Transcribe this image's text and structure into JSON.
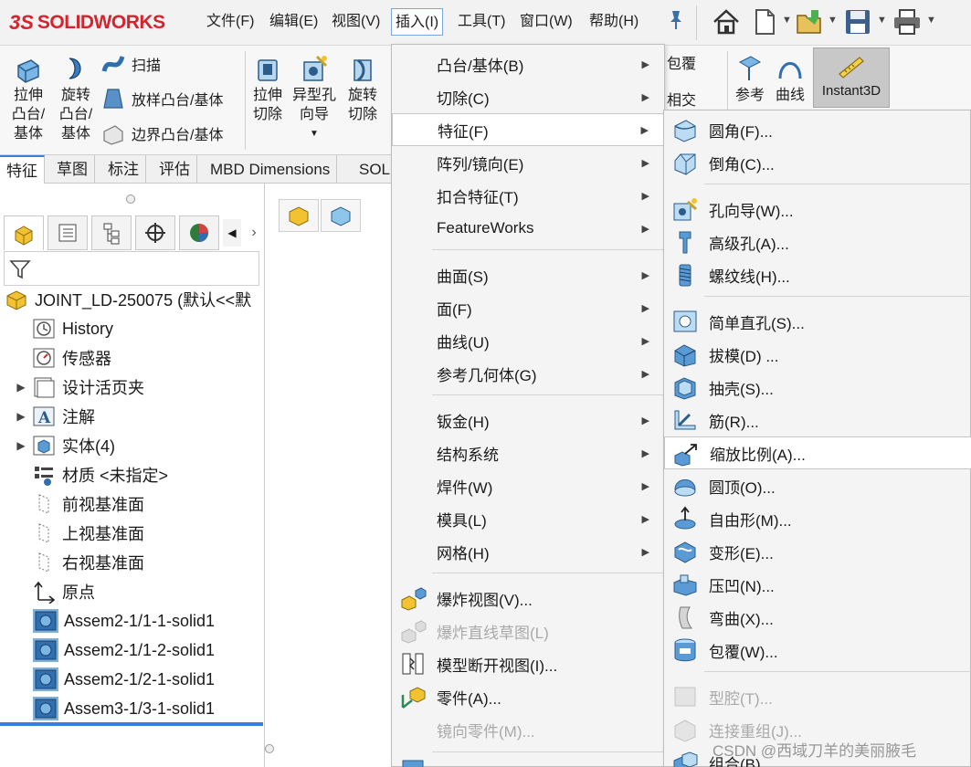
{
  "app": {
    "logo_prefix": "3S",
    "logo_text": "SOLIDWORKS",
    "accent": "#d6232e",
    "selection_color": "#9dc3e6",
    "highlight_blue": "#3b7dd8"
  },
  "menubar": [
    {
      "label": "文件(F)"
    },
    {
      "label": "编辑(E)"
    },
    {
      "label": "视图(V)"
    },
    {
      "label": "插入(I)",
      "active": true
    },
    {
      "label": "工具(T)"
    },
    {
      "label": "窗口(W)"
    },
    {
      "label": "帮助(H)"
    }
  ],
  "quick_access": [
    "home-icon",
    "new-document-icon",
    "open-icon",
    "save-icon",
    "print-icon"
  ],
  "commands": {
    "extrude_boss": "拉伸\n凸台/\n基体",
    "revolve_boss": "旋转\n凸台/\n基体",
    "sweep": "扫描",
    "loft": "放样凸台/基体",
    "boundary": "边界凸台/基体",
    "extrude_cut": "拉伸\n切除",
    "hole_wizard": "异型孔\n向导",
    "revolve_cut": "旋转\n切除",
    "wrap": "包覆",
    "intersect": "相交",
    "reference": "参考",
    "curves": "曲线",
    "instant3d": "Instant3D"
  },
  "command_tabs": [
    {
      "label": "特征",
      "active": true
    },
    {
      "label": "草图"
    },
    {
      "label": "标注"
    },
    {
      "label": "评估"
    },
    {
      "label": "MBD Dimensions"
    },
    {
      "label": "SOL"
    }
  ],
  "tree": {
    "root": "JOINT_LD-250075  (默认<<默",
    "items": [
      {
        "label": "History",
        "icon": "history-icon",
        "expandable": false
      },
      {
        "label": "传感器",
        "icon": "sensor-icon",
        "expandable": false
      },
      {
        "label": "设计活页夹",
        "icon": "design-binder-icon",
        "expandable": true
      },
      {
        "label": "注解",
        "icon": "annotation-icon",
        "expandable": true
      },
      {
        "label": "实体(4)",
        "icon": "solid-bodies-icon",
        "expandable": true
      },
      {
        "label": "材质 <未指定>",
        "icon": "material-icon",
        "expandable": false
      },
      {
        "label": "前视基准面",
        "icon": "plane-icon",
        "expandable": false
      },
      {
        "label": "上视基准面",
        "icon": "plane-icon",
        "expandable": false
      },
      {
        "label": "右视基准面",
        "icon": "plane-icon",
        "expandable": false
      },
      {
        "label": "原点",
        "icon": "origin-icon",
        "expandable": false
      },
      {
        "label": "Assem2-1/1-1-solid1",
        "icon": "part-body-icon",
        "selected": true
      },
      {
        "label": "Assem2-1/1-2-solid1",
        "icon": "part-body-icon",
        "selected": true
      },
      {
        "label": "Assem2-1/2-1-solid1",
        "icon": "part-body-icon",
        "selected": true
      },
      {
        "label": "Assem3-1/3-1-solid1",
        "icon": "part-body-icon",
        "selected": true
      }
    ]
  },
  "insert_menu": {
    "items": [
      {
        "label": "凸台/基体(B)",
        "submenu": true
      },
      {
        "label": "切除(C)",
        "submenu": true
      },
      {
        "label": "特征(F)",
        "submenu": true,
        "hover": true
      },
      {
        "label": "阵列/镜向(E)",
        "submenu": true
      },
      {
        "label": "扣合特征(T)",
        "submenu": true
      },
      {
        "label": "FeatureWorks",
        "submenu": true
      },
      {
        "label": "曲面(S)",
        "submenu": true
      },
      {
        "label": "面(F)",
        "submenu": true
      },
      {
        "label": "曲线(U)",
        "submenu": true
      },
      {
        "label": "参考几何体(G)",
        "submenu": true
      },
      {
        "label": "钣金(H)",
        "submenu": true
      },
      {
        "label": "结构系统",
        "submenu": true
      },
      {
        "label": "焊件(W)",
        "submenu": true
      },
      {
        "label": "模具(L)",
        "submenu": true
      },
      {
        "label": "网格(H)",
        "submenu": true
      },
      {
        "label": "爆炸视图(V)...",
        "icon": "exploded-view-icon"
      },
      {
        "label": "爆炸直线草图(L)",
        "icon": "explode-line-sketch-icon",
        "disabled": true
      },
      {
        "label": "模型断开视图(I)...",
        "icon": "model-break-view-icon"
      },
      {
        "label": "零件(A)...",
        "icon": "insert-part-icon"
      },
      {
        "label": "镜向零件(M)...",
        "disabled": true
      },
      {
        "label": "",
        "icon": "more-icon"
      }
    ]
  },
  "feature_menu": {
    "items": [
      {
        "label": "圆角(F)...",
        "icon": "fillet-icon"
      },
      {
        "label": "倒角(C)...",
        "icon": "chamfer-icon"
      },
      {
        "label": "孔向导(W)...",
        "icon": "hole-wizard-icon"
      },
      {
        "label": "高级孔(A)...",
        "icon": "advanced-hole-icon"
      },
      {
        "label": "螺纹线(H)...",
        "icon": "thread-icon"
      },
      {
        "label": "简单直孔(S)...",
        "icon": "simple-hole-icon"
      },
      {
        "label": "拔模(D) ...",
        "icon": "draft-icon"
      },
      {
        "label": "抽壳(S)...",
        "icon": "shell-icon"
      },
      {
        "label": "筋(R)...",
        "icon": "rib-icon"
      },
      {
        "label": "缩放比例(A)...",
        "icon": "scale-icon",
        "hover": true
      },
      {
        "label": "圆顶(O)...",
        "icon": "dome-icon"
      },
      {
        "label": "自由形(M)...",
        "icon": "freeform-icon"
      },
      {
        "label": "变形(E)...",
        "icon": "deform-icon"
      },
      {
        "label": "压凹(N)...",
        "icon": "indent-icon"
      },
      {
        "label": "弯曲(X)...",
        "icon": "flex-icon"
      },
      {
        "label": "包覆(W)...",
        "icon": "wrap-icon"
      },
      {
        "label": "型腔(T)...",
        "icon": "cavity-icon",
        "disabled": true
      },
      {
        "label": "连接重组(J)...",
        "icon": "join-icon",
        "disabled": true
      },
      {
        "label": "组合(B)...",
        "icon": "combine-icon"
      }
    ]
  },
  "watermark": "CSDN @西域刀羊的美丽腋毛"
}
